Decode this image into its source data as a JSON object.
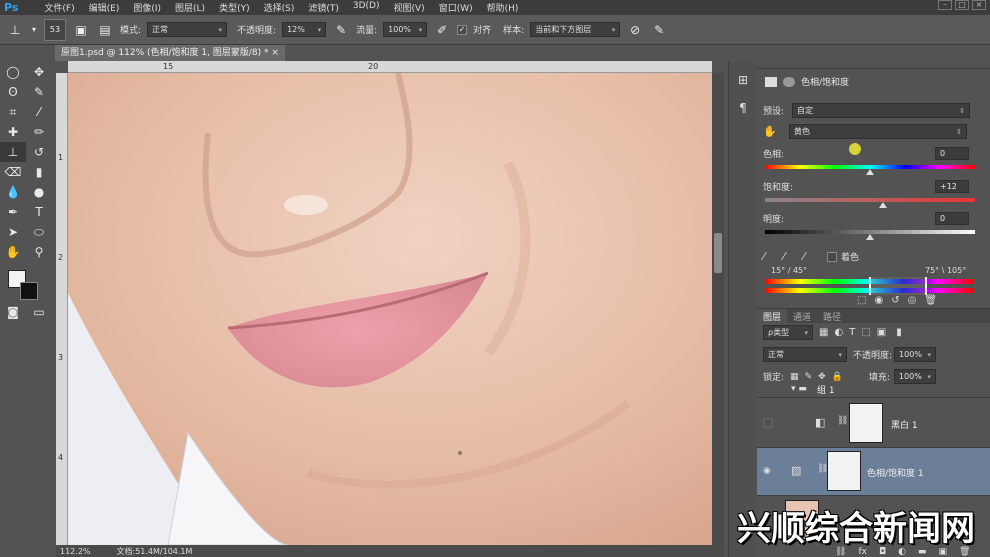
{
  "app": {
    "logo": "Ps"
  },
  "menu": [
    "文件(F)",
    "编辑(E)",
    "图像(I)",
    "图层(L)",
    "类型(Y)",
    "选择(S)",
    "滤镜(T)",
    "3D(D)",
    "视图(V)",
    "窗口(W)",
    "帮助(H)"
  ],
  "options": {
    "brush_size": "53",
    "mode_label": "模式:",
    "mode_value": "正常",
    "opacity_label": "不透明度:",
    "opacity_value": "12%",
    "flow_label": "流量:",
    "flow_value": "100%",
    "align_label": "对齐",
    "sample_label": "样本:",
    "sample_value": "当前和下方图层"
  },
  "document": {
    "tab_title": "原图1.psd @ 112% (色相/饱和度 1, 图层蒙版/8) *",
    "ruler_top": [
      "15",
      "20"
    ],
    "ruler_left": [
      "1",
      "2",
      "3",
      "4"
    ],
    "zoom": "112.2%",
    "doc_size": "文档:51.4M/104.1M"
  },
  "properties": {
    "title": "色相/饱和度",
    "preset_label": "预设:",
    "preset_value": "自定",
    "channel_value": "黄色",
    "hue_label": "色相:",
    "hue_value": "0",
    "hue_level": 0.5,
    "saturation_label": "饱和度:",
    "saturation_value": "+12",
    "saturation_level": 0.56,
    "lightness_label": "明度:",
    "lightness_value": "0",
    "lightness_level": 0.5,
    "colorize_label": "着色",
    "range_left": "15° / 45°",
    "range_right": "75° \\ 105°"
  },
  "layers": {
    "tabs": [
      "图层",
      "通道",
      "路径"
    ],
    "kind_filter": "ρ类型",
    "blend_mode": "正常",
    "opacity_label": "不透明度:",
    "opacity_value": "100%",
    "lock_label": "锁定:",
    "fill_label": "填充:",
    "fill_value": "100%",
    "items": [
      {
        "name": "组 1"
      },
      {
        "name": "黑白 1"
      },
      {
        "name": "色相/饱和度 1"
      }
    ]
  },
  "watermark": "兴顺综合新闻网",
  "colors": {
    "menubar": "#3c3c3c",
    "panel": "#535353",
    "selected_layer": "#6c7f99",
    "accent": "#2fa3f0"
  }
}
